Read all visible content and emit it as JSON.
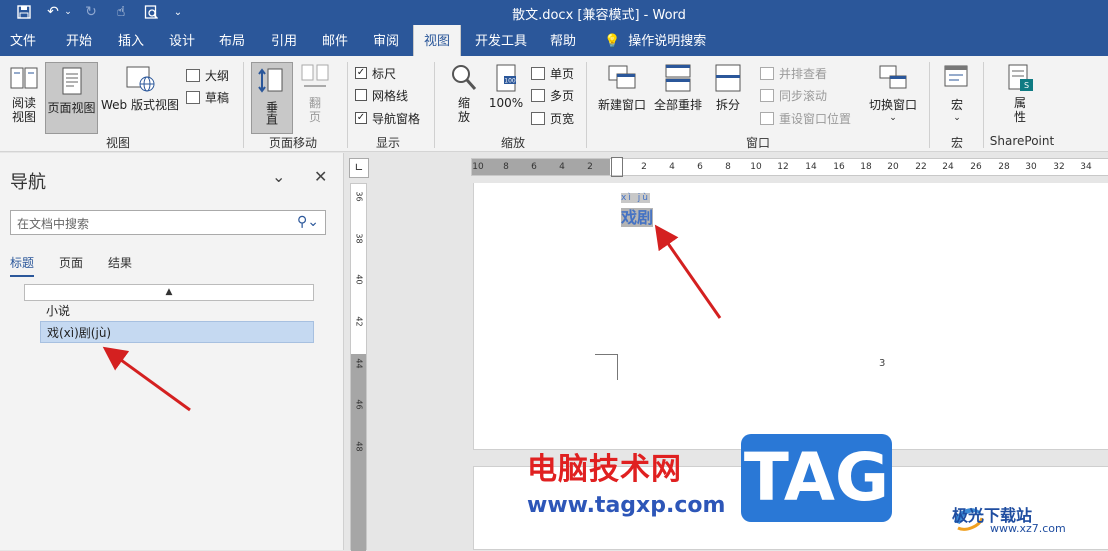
{
  "titlebar": {
    "title": "散文.docx [兼容模式]  -  Word",
    "qa_icons": [
      "save-icon",
      "undo-icon",
      "undo-dropdown-icon",
      "redo-icon",
      "touch-mode-icon",
      "print-preview-icon",
      "customize-qat-icon"
    ]
  },
  "tabs": [
    "文件",
    "开始",
    "插入",
    "设计",
    "布局",
    "引用",
    "邮件",
    "审阅",
    "视图",
    "开发工具",
    "帮助",
    "操作说明搜索"
  ],
  "active_tab": "视图",
  "ribbon": {
    "view": {
      "read": "阅读\n视图",
      "print": "页面视图",
      "web": "Web 版式视图",
      "outline": "大纲",
      "draft": "草稿",
      "label": "视图"
    },
    "pagemove": {
      "vertical": "垂直",
      "side": "翻\n页",
      "label": "页面移动"
    },
    "show": {
      "ruler": "标尺",
      "grid": "网格线",
      "navpane": "导航窗格",
      "label": "显示"
    },
    "zoom": {
      "zoom": "缩\n放",
      "hundred": "100%",
      "one": "单页",
      "multi": "多页",
      "width": "页宽",
      "label": "缩放"
    },
    "window": {
      "new": "新建窗口",
      "arrange": "全部重排",
      "split": "拆分",
      "side": "并排查看",
      "sync": "同步滚动",
      "reset": "重设窗口位置",
      "switch": "切换窗口",
      "label": "窗口"
    },
    "macro": {
      "macro": "宏",
      "label": "宏"
    },
    "sp": {
      "props": "属\n性",
      "label": "SharePoint"
    }
  },
  "nav": {
    "title": "导航",
    "search_placeholder": "在文档中搜索",
    "tabs": [
      "标题",
      "页面",
      "结果"
    ],
    "headings": [
      "小说",
      "戏(xì)剧(jù)"
    ]
  },
  "ruler": {
    "h": [
      "10",
      "8",
      "6",
      "4",
      "2",
      "2",
      "4",
      "6",
      "8",
      "10",
      "12",
      "14",
      "16",
      "18",
      "20",
      "22",
      "24",
      "26",
      "28",
      "30",
      "32",
      "34"
    ],
    "v": [
      "36",
      "38",
      "40",
      "42",
      "44",
      "46",
      "48"
    ]
  },
  "doc": {
    "ruby": "xì jù",
    "heading": "戏剧",
    "page_number": "3"
  },
  "watermark": {
    "cn": "电脑技术网",
    "url": "www.tagxp.com",
    "tag": "TAG",
    "site": "极光下载站",
    "site_url": "www.xz7.com"
  }
}
